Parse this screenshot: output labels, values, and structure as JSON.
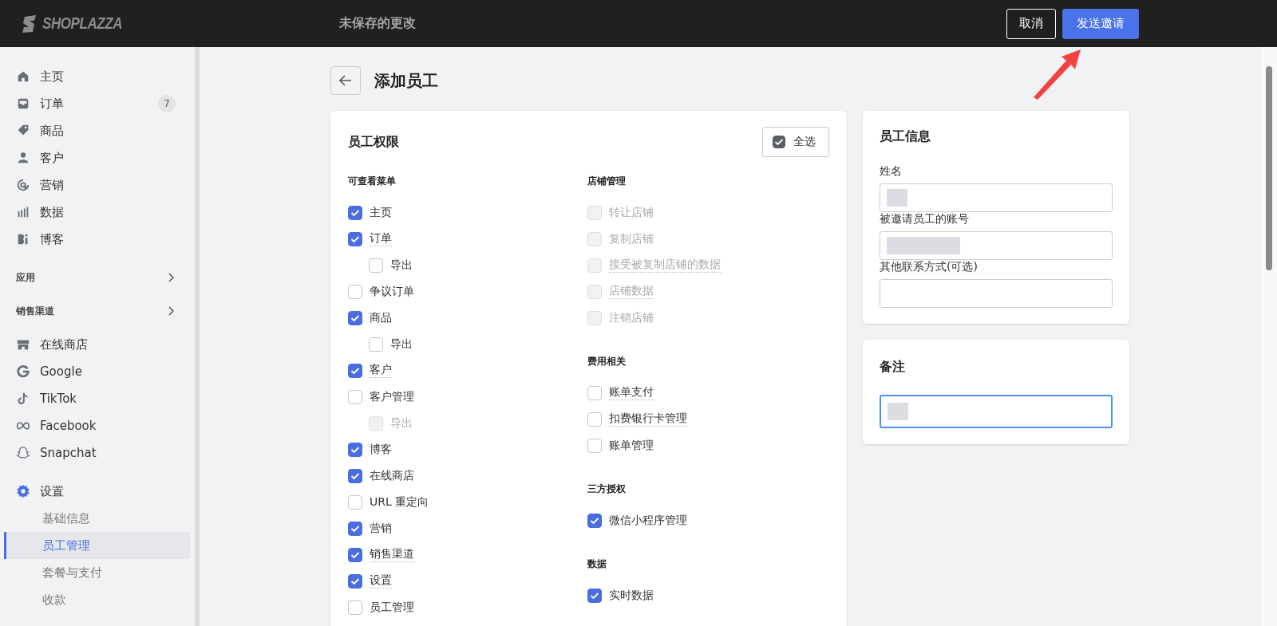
{
  "header": {
    "logo": "SHOPLAZZA",
    "title": "未保存的更改",
    "buttons": [
      {
        "label": "取消",
        "kind": "secondary"
      },
      {
        "label": "发送邀请",
        "kind": "primary"
      }
    ]
  },
  "sidebar": [
    {
      "kind": "nav",
      "items": [
        {
          "label": "主页",
          "active": false
        },
        {
          "label": "订单",
          "badge": "7",
          "active": false
        },
        {
          "label": "商品",
          "active": false
        },
        {
          "label": "客户",
          "active": false
        },
        {
          "label": "营销",
          "active": false
        },
        {
          "label": "数据",
          "active": false
        },
        {
          "label": "博客",
          "active": false
        }
      ]
    },
    {
      "kind": "section",
      "label": "应用"
    },
    {
      "kind": "section",
      "label": "销售渠道"
    },
    {
      "kind": "nav",
      "items": [
        {
          "label": "在线商店",
          "active": false
        },
        {
          "label": "Google",
          "active": false
        },
        {
          "label": "TikTok",
          "active": false
        },
        {
          "label": "Facebook",
          "active": false
        },
        {
          "label": "Snapchat",
          "active": false
        }
      ]
    },
    {
      "kind": "nav",
      "items": [
        {
          "label": "设置",
          "active": true,
          "children": [
            {
              "label": "基础信息",
              "selected": false
            },
            {
              "label": "员工管理",
              "selected": true
            },
            {
              "label": "套餐与支付",
              "selected": false
            },
            {
              "label": "收款",
              "selected": false
            }
          ]
        }
      ]
    }
  ],
  "page": {
    "title": "添加员工"
  },
  "permissions": {
    "title": "员工权限",
    "select_all": {
      "label": "全选",
      "checked": true
    },
    "columns": [
      [
        {
          "heading": "可查看菜单",
          "items": [
            {
              "label": "主页",
              "checked": true,
              "disabled": false,
              "tip": false
            },
            {
              "label": "订单",
              "checked": true,
              "disabled": false,
              "tip": true,
              "children": [
                {
                  "label": "导出",
                  "checked": false,
                  "disabled": false,
                  "tip": false
                }
              ]
            },
            {
              "label": "争议订单",
              "checked": false,
              "disabled": false,
              "tip": false
            },
            {
              "label": "商品",
              "checked": true,
              "disabled": false,
              "tip": false,
              "children": [
                {
                  "label": "导出",
                  "checked": false,
                  "disabled": false,
                  "tip": false
                }
              ]
            },
            {
              "label": "客户",
              "checked": true,
              "disabled": false,
              "tip": true
            },
            {
              "label": "客户管理",
              "checked": false,
              "disabled": false,
              "tip": false,
              "children": [
                {
                  "label": "导出",
                  "checked": false,
                  "disabled": true,
                  "tip": false
                }
              ]
            },
            {
              "label": "博客",
              "checked": true,
              "disabled": false,
              "tip": false
            },
            {
              "label": "在线商店",
              "checked": true,
              "disabled": false,
              "tip": false
            },
            {
              "label": "URL 重定向",
              "checked": false,
              "disabled": false,
              "tip": false
            },
            {
              "label": "营销",
              "checked": true,
              "disabled": false,
              "tip": false
            },
            {
              "label": "销售渠道",
              "checked": true,
              "disabled": false,
              "tip": true
            },
            {
              "label": "设置",
              "checked": true,
              "disabled": false,
              "tip": true
            },
            {
              "label": "员工管理",
              "checked": false,
              "disabled": false,
              "tip": false
            }
          ]
        }
      ],
      [
        {
          "heading": "店铺管理",
          "items": [
            {
              "label": "转让店铺",
              "checked": false,
              "disabled": true,
              "tip": false
            },
            {
              "label": "复制店铺",
              "checked": false,
              "disabled": true,
              "tip": false
            },
            {
              "label": "接受被复制店铺的数据",
              "checked": false,
              "disabled": true,
              "tip": true
            },
            {
              "label": "店铺数据",
              "checked": false,
              "disabled": true,
              "tip": true
            },
            {
              "label": "注销店铺",
              "checked": false,
              "disabled": true,
              "tip": false
            }
          ]
        },
        {
          "heading": "费用相关",
          "items": [
            {
              "label": "账单支付",
              "checked": false,
              "disabled": false,
              "tip": true
            },
            {
              "label": "扣费银行卡管理",
              "checked": false,
              "disabled": false,
              "tip": true
            },
            {
              "label": "账单管理",
              "checked": false,
              "disabled": false,
              "tip": false
            }
          ]
        },
        {
          "heading": "三方授权",
          "items": [
            {
              "label": "微信小程序管理",
              "checked": true,
              "disabled": false,
              "tip": false
            }
          ]
        },
        {
          "heading": "数据",
          "items": [
            {
              "label": "实时数据",
              "checked": true,
              "disabled": false,
              "tip": false
            }
          ]
        }
      ]
    ]
  },
  "staff_info": {
    "title": "员工信息",
    "fields": [
      {
        "label": "姓名",
        "redacted": true
      },
      {
        "label": "被邀请员工的账号",
        "redacted": true
      },
      {
        "label": "其他联系方式(可选)",
        "redacted": false
      }
    ]
  },
  "notes": {
    "title": "备注",
    "focused": true,
    "redacted": true
  }
}
